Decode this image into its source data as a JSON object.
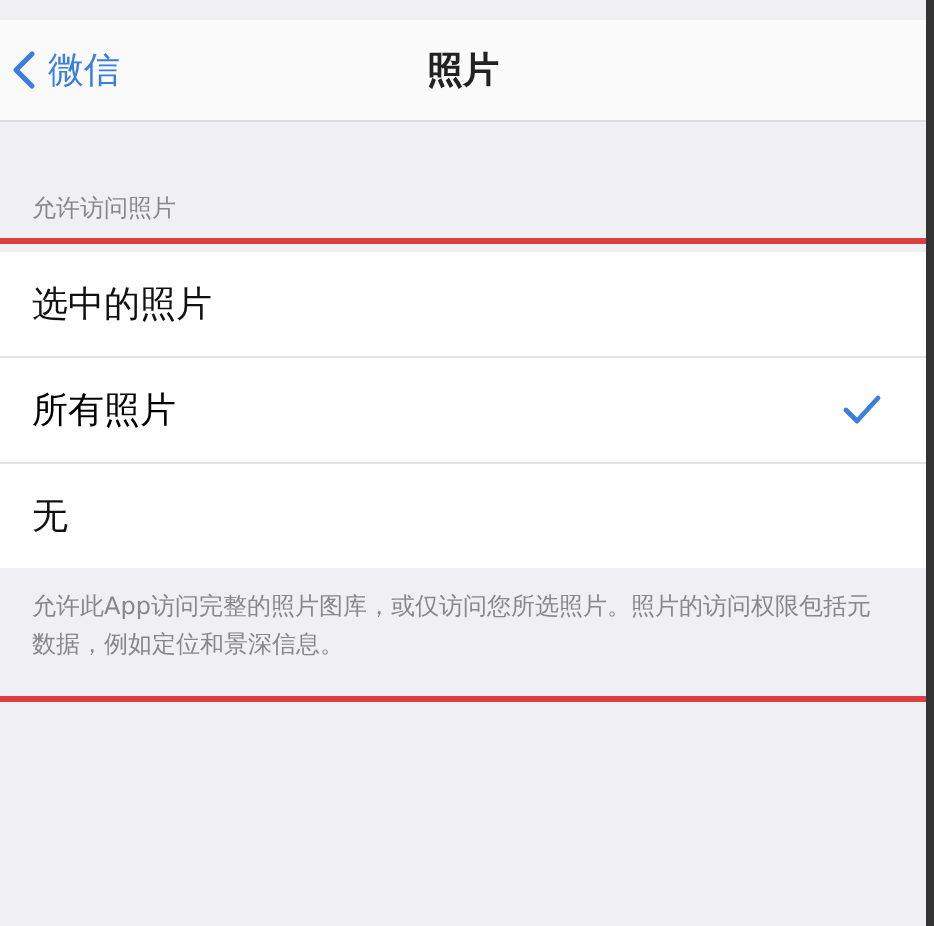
{
  "nav_bar": {
    "back_label": "微信",
    "title": "照片"
  },
  "section": {
    "header": "允许访问照片",
    "options": [
      {
        "label": "选中的照片",
        "selected": false
      },
      {
        "label": "所有照片",
        "selected": true
      },
      {
        "label": "无",
        "selected": false
      }
    ],
    "footer": "允许此App访问完整的照片图库，或仅访问您所选照片。照片的访问权限包括元数据，例如定位和景深信息。"
  }
}
